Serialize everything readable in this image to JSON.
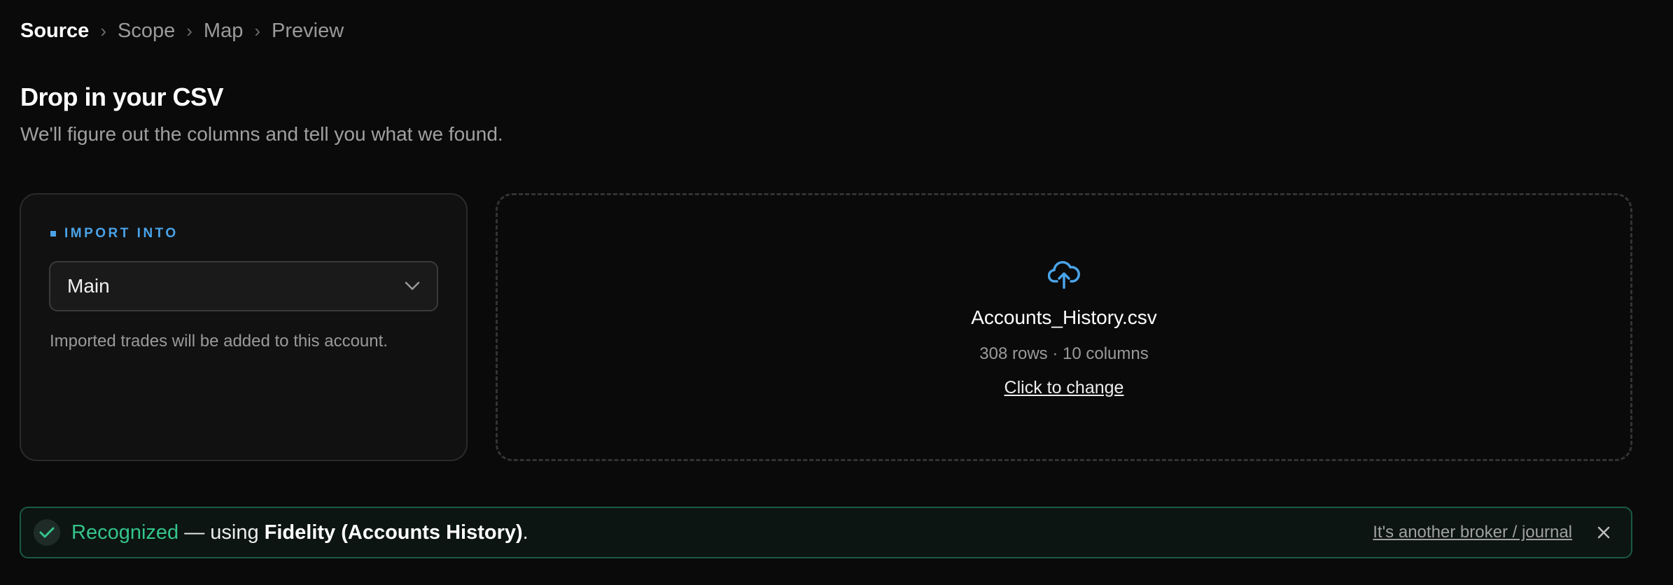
{
  "stepper": {
    "steps": [
      "Source",
      "Scope",
      "Map",
      "Preview"
    ],
    "active": "Source",
    "separator": "›"
  },
  "header": {
    "title": "Drop in your CSV",
    "subtitle": "We'll figure out the columns and tell you what we found."
  },
  "import_into": {
    "label": "IMPORT INTO",
    "selected_account": "Main",
    "hint": "Imported trades will be added to this account."
  },
  "dropzone": {
    "icon": "cloud-upload-icon",
    "file_name": "Accounts_History.csv",
    "meta": "308 rows · 10 columns",
    "change_label": "Click to change"
  },
  "banner": {
    "status": "Recognized",
    "middle": " — using ",
    "broker": "Fidelity (Accounts History)",
    "end": ".",
    "alt_link": "It's another broker / journal"
  },
  "colors": {
    "accent": "#4aa3e8",
    "success": "#34c48b",
    "background": "#0a0a0a"
  }
}
